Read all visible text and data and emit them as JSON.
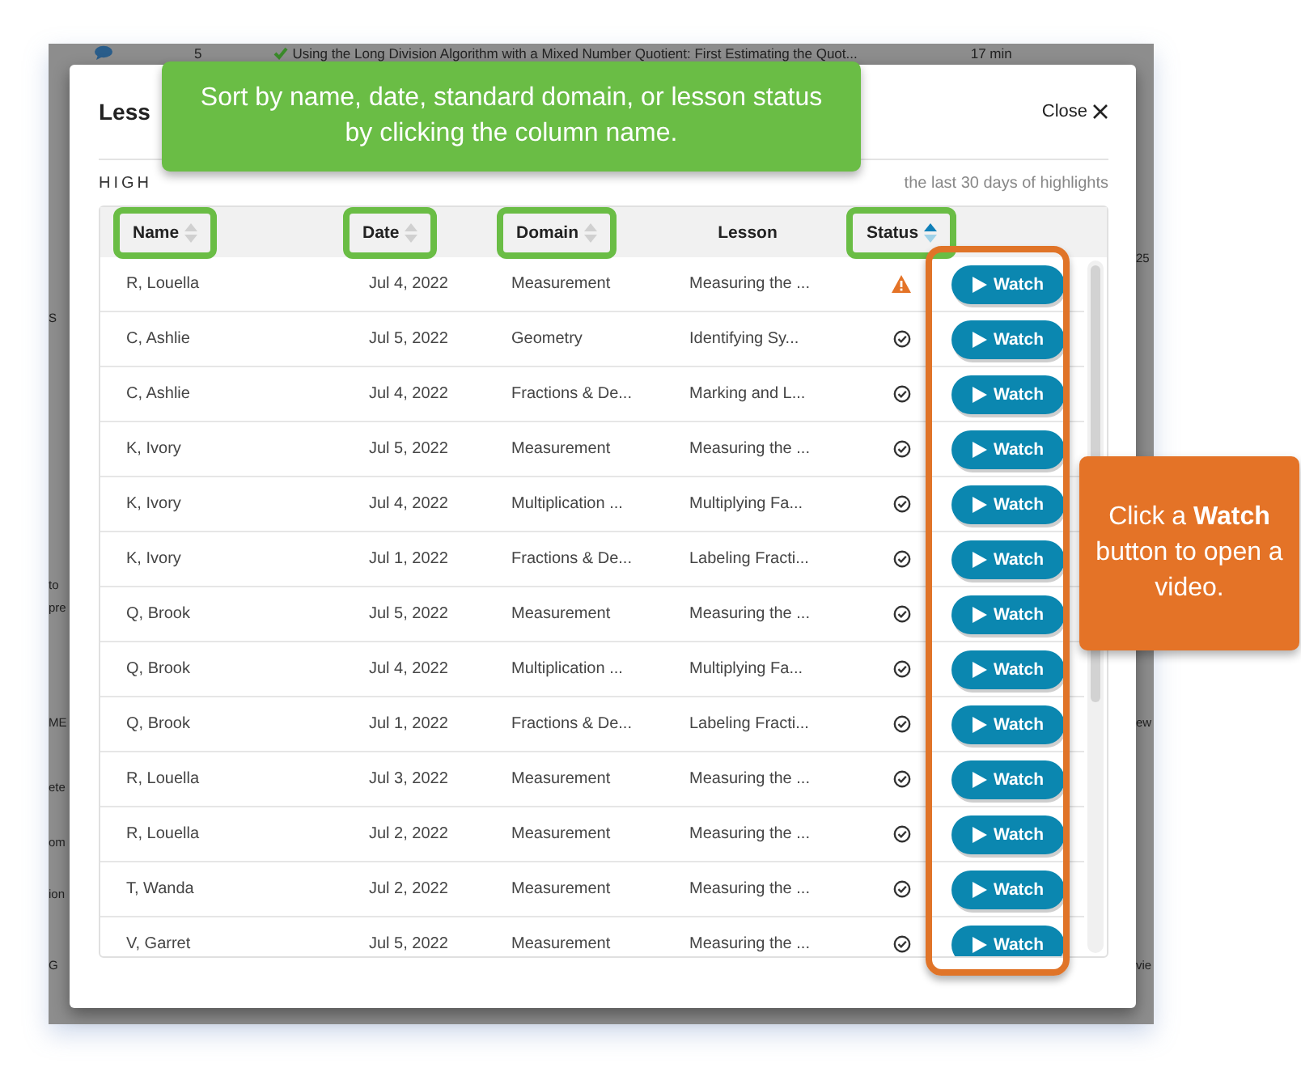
{
  "background": {
    "top_row": {
      "count": "5",
      "title": "Using the Long Division Algorithm with a Mixed Number Quotient: First Estimating the Quot...",
      "duration": "17 min"
    },
    "left_fragments": [
      "S",
      "to",
      "pre",
      "ME",
      "ete",
      "om",
      "ion",
      "G"
    ],
    "right_fragments": [
      "25",
      "ew",
      "vie"
    ]
  },
  "modal": {
    "title": "Less",
    "subtitle": "HIGH",
    "note": "the last 30 days of highlights",
    "close": "Close"
  },
  "table": {
    "columns": [
      {
        "label": "Name",
        "kind": "sortable",
        "sorted": false,
        "highlighted": true
      },
      {
        "label": "Date",
        "kind": "sortable",
        "sorted": false,
        "highlighted": true
      },
      {
        "label": "Domain",
        "kind": "sortable",
        "sorted": false,
        "highlighted": true
      },
      {
        "label": "Lesson",
        "kind": "plain",
        "highlighted": false
      },
      {
        "label": "Status",
        "kind": "sortable",
        "sorted": true,
        "highlighted": true
      }
    ],
    "rows": [
      {
        "name": "R, Louella",
        "date": "Jul 4, 2022",
        "domain": "Measurement",
        "lesson": "Measuring the ...",
        "kind": "warning",
        "action": "Watch"
      },
      {
        "name": "C, Ashlie",
        "date": "Jul 5, 2022",
        "domain": "Geometry",
        "lesson": "Identifying Sy...",
        "kind": "done",
        "action": "Watch"
      },
      {
        "name": "C, Ashlie",
        "date": "Jul 4, 2022",
        "domain": "Fractions & De...",
        "lesson": "Marking and L...",
        "kind": "done",
        "action": "Watch"
      },
      {
        "name": "K, Ivory",
        "date": "Jul 5, 2022",
        "domain": "Measurement",
        "lesson": "Measuring the ...",
        "kind": "done",
        "action": "Watch"
      },
      {
        "name": "K, Ivory",
        "date": "Jul 4, 2022",
        "domain": "Multiplication ...",
        "lesson": "Multiplying Fa...",
        "kind": "done",
        "action": "Watch"
      },
      {
        "name": "K, Ivory",
        "date": "Jul 1, 2022",
        "domain": "Fractions & De...",
        "lesson": "Labeling Fracti...",
        "kind": "done",
        "action": "Watch"
      },
      {
        "name": "Q, Brook",
        "date": "Jul 5, 2022",
        "domain": "Measurement",
        "lesson": "Measuring the ...",
        "kind": "done",
        "action": "Watch"
      },
      {
        "name": "Q, Brook",
        "date": "Jul 4, 2022",
        "domain": "Multiplication ...",
        "lesson": "Multiplying Fa...",
        "kind": "done",
        "action": "Watch"
      },
      {
        "name": "Q, Brook",
        "date": "Jul 1, 2022",
        "domain": "Fractions & De...",
        "lesson": "Labeling Fracti...",
        "kind": "done",
        "action": "Watch"
      },
      {
        "name": "R, Louella",
        "date": "Jul 3, 2022",
        "domain": "Measurement",
        "lesson": "Measuring the ...",
        "kind": "done",
        "action": "Watch"
      },
      {
        "name": "R, Louella",
        "date": "Jul 2, 2022",
        "domain": "Measurement",
        "lesson": "Measuring the ...",
        "kind": "done",
        "action": "Watch"
      },
      {
        "name": "T, Wanda",
        "date": "Jul 2, 2022",
        "domain": "Measurement",
        "lesson": "Measuring the ...",
        "kind": "done",
        "action": "Watch"
      },
      {
        "name": "V, Garret",
        "date": "Jul 5, 2022",
        "domain": "Measurement",
        "lesson": "Measuring the ...",
        "kind": "done",
        "action": "Watch"
      }
    ]
  },
  "callouts": [
    {
      "kind": "sort",
      "text": "Sort by name, date, standard domain, or lesson status by clicking the column name."
    },
    {
      "kind": "watch",
      "text": "Click a **Watch** button to open a video."
    }
  ]
}
